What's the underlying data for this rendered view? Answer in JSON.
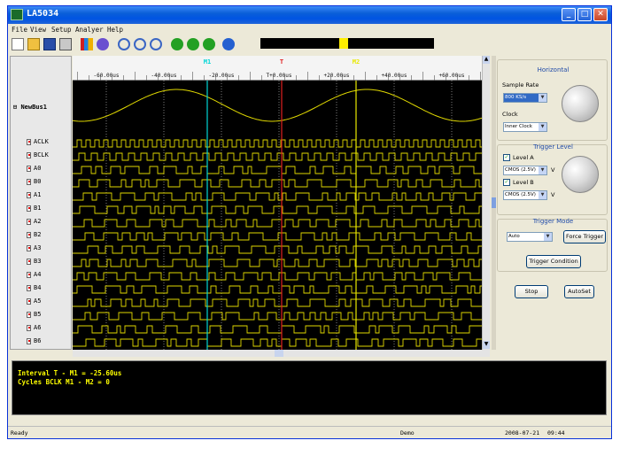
{
  "window": {
    "title": "LA5034"
  },
  "menu": [
    "File",
    "View",
    "Setup",
    "Analyer",
    "Help"
  ],
  "toolbar_icons": [
    "new-icon",
    "open-icon",
    "save-icon",
    "print-icon",
    "bar-chart-icon",
    "settings-icon",
    "zoom-in-icon",
    "zoom-out-icon",
    "zoom-fit-icon",
    "back-icon",
    "forward-icon",
    "next-icon",
    "help-icon"
  ],
  "capture_position": 0.48,
  "markers": {
    "m1": "M1",
    "t": "T",
    "m2": "M2"
  },
  "ruler_labels": [
    "-60.00us",
    "-40.00us",
    "-20.00us",
    "T+0.00us",
    "+20.00us",
    "+40.00us",
    "+60.00us"
  ],
  "bus": {
    "name": "NewBus1",
    "expander": "⊟"
  },
  "signals": [
    "ACLK",
    "BCLK",
    "A0",
    "B0",
    "A1",
    "B1",
    "A2",
    "B2",
    "A3",
    "B3",
    "A4",
    "B4",
    "A5",
    "B5",
    "A6",
    "B6"
  ],
  "horizontal": {
    "heading": "Horizontal",
    "sample_rate_label": "Sample Rate",
    "sample_rate_value": "800 KS/s",
    "clock_label": "Clock",
    "clock_value": "Inner Clock"
  },
  "trigger_level": {
    "heading": "Trigger Level",
    "level_a_label": "Level A",
    "level_a_value": "CMOS (2.5V)",
    "level_b_label": "Level B",
    "level_b_value": "CMOS (2.5V)",
    "unit": "V"
  },
  "trigger_mode": {
    "heading": "Trigger Mode",
    "mode_value": "Auto",
    "force_trigger": "Force Trigger",
    "trigger_condition": "Trigger Condition"
  },
  "actions": {
    "stop": "Stop",
    "autoset": "AutoSet"
  },
  "output": {
    "line1": "Interval  T - M1 = -25.60us",
    "line2": "Cycles  BCLK  M1 - M2 = 0"
  },
  "status": {
    "ready": "Ready",
    "mode": "Demo",
    "date": "2008-07-21",
    "time": "09:44"
  },
  "colors": {
    "trace": "#e0d800",
    "m1": "#00d6d6",
    "t": "#e02020",
    "m2": "#e8e800"
  }
}
